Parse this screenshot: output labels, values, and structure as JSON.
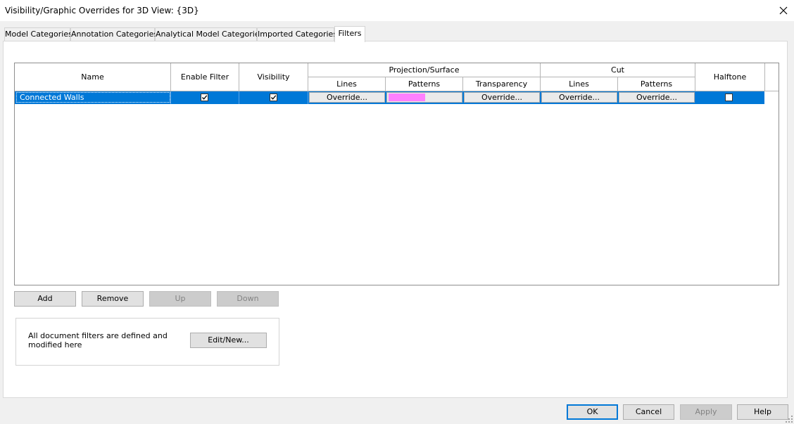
{
  "window": {
    "title": "Visibility/Graphic Overrides for 3D View: {3D}"
  },
  "tabs": [
    {
      "label": "Model Categories",
      "active": false
    },
    {
      "label": "Annotation Categories",
      "active": false
    },
    {
      "label": "Analytical Model Categories",
      "active": false
    },
    {
      "label": "Imported Categories",
      "active": false
    },
    {
      "label": "Filters",
      "active": true
    }
  ],
  "grid": {
    "headers": {
      "name": "Name",
      "enable_filter": "Enable Filter",
      "visibility": "Visibility",
      "projection_surface": "Projection/Surface",
      "proj_lines": "Lines",
      "proj_patterns": "Patterns",
      "proj_transparency": "Transparency",
      "cut": "Cut",
      "cut_lines": "Lines",
      "cut_patterns": "Patterns",
      "halftone": "Halftone"
    },
    "rows": [
      {
        "name": "Connected Walls",
        "enable_filter": true,
        "visibility": true,
        "proj_lines_btn": "Override...",
        "proj_pattern_color": "#ff80ff",
        "proj_transparency_btn": "Override...",
        "cut_lines_btn": "Override...",
        "cut_patterns_btn": "Override...",
        "halftone": false,
        "selected": true
      }
    ]
  },
  "row_buttons": {
    "add": "Add",
    "remove": "Remove",
    "up": "Up",
    "down": "Down"
  },
  "info": {
    "text": "All document filters are defined and modified here",
    "edit_new": "Edit/New..."
  },
  "footer": {
    "ok": "OK",
    "cancel": "Cancel",
    "apply": "Apply",
    "help": "Help"
  },
  "colors": {
    "selection": "#0078d7",
    "accent": "#0078d7",
    "pattern_swatch": "#ff80ff"
  }
}
